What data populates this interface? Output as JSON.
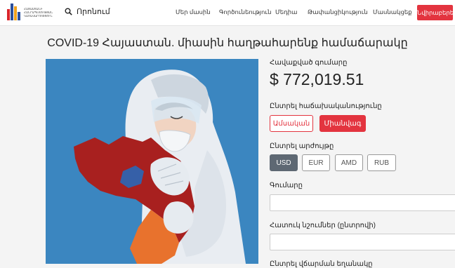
{
  "nav": {
    "logo_text": "ՀԱՅԱՍՏԱՆԻ ՀԱՆՐԱՊԵՏՈՒԹՅԱՆ ԿԱՌԱՎԱՐՈՒԹՅՈՒՆ",
    "search_label": "Որոնում",
    "items": [
      "Մեր մասին",
      "Գործունեություն",
      "Մեդիա",
      "Թափանցիկություն",
      "Մասնակցեք"
    ],
    "donate_label": "Նվիրաբերել"
  },
  "page": {
    "title": "COVID-19 Հայաստան. միասին հաղթահարենք համաճարակը"
  },
  "donation": {
    "raised_label": "Հավաքված գումարը",
    "raised_amount": "$ 772,019.51",
    "frequency_label": "Ընտրել հաճախականությունը",
    "frequency_options": [
      "Ամսական",
      "Միանվագ"
    ],
    "frequency_selected": "Միանվագ",
    "currency_label": "Ընտրել արժույթը",
    "currencies": [
      "USD",
      "EUR",
      "AMD",
      "RUB"
    ],
    "currency_selected": "USD",
    "amount_label": "Գումարը",
    "notes_label": "Հատուկ նշումներ (ընտրովի)",
    "next_label": "Ընտրել վճարման եղանակը"
  },
  "colors": {
    "accent": "#e3343f",
    "illustration_bg": "#3b86c0",
    "map_red": "#a8201f",
    "map_blue": "#3660a8",
    "map_orange": "#e8722d",
    "active_currency": "#5e6873"
  }
}
